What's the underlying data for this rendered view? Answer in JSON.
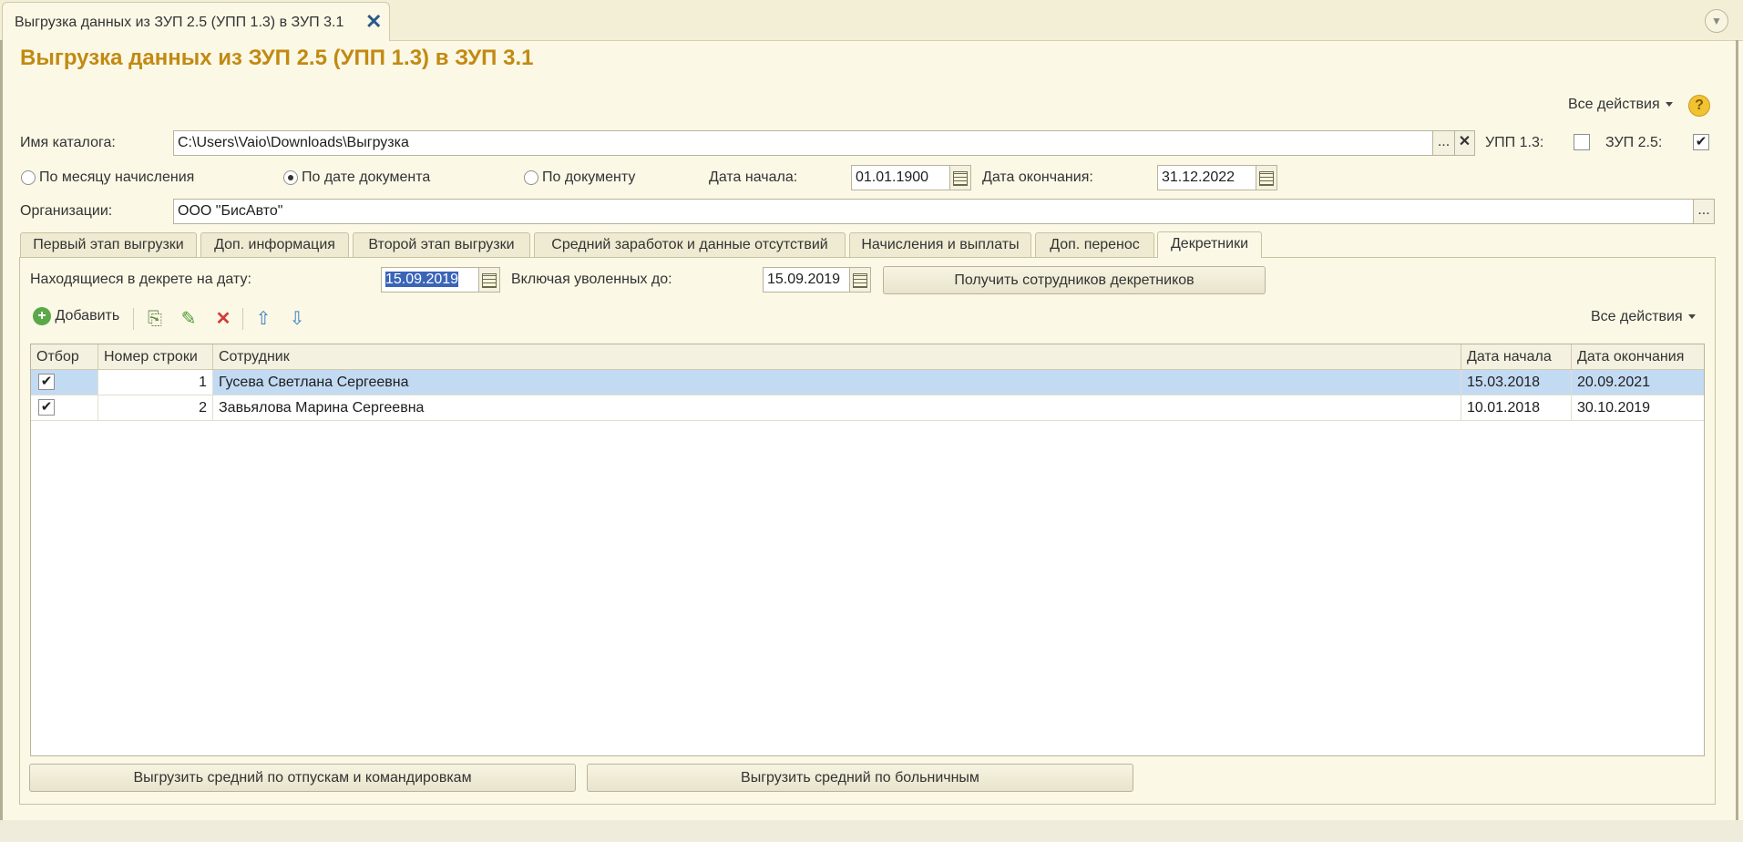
{
  "window_tab": {
    "title": "Выгрузка данных из ЗУП 2.5 (УПП 1.3) в ЗУП 3.1"
  },
  "page_title": "Выгрузка данных из ЗУП 2.5 (УПП 1.3) в ЗУП 3.1",
  "all_actions": "Все действия",
  "help_symbol": "?",
  "catalog": {
    "label": "Имя каталога:",
    "value": "C:\\Users\\Vaio\\Downloads\\Выгрузка",
    "select_symbol": "...",
    "clear_symbol": "✕"
  },
  "upp": {
    "label": "УПП 1.3:",
    "checked": false
  },
  "zup": {
    "label": "ЗУП 2.5:",
    "checked": true
  },
  "radios": [
    {
      "label": "По месяцу начисления",
      "selected": false
    },
    {
      "label": "По дате документа",
      "selected": true
    },
    {
      "label": "По документу",
      "selected": false
    }
  ],
  "date_start": {
    "label": "Дата начала:",
    "value": "01.01.1900"
  },
  "date_end": {
    "label": "Дата окончания:",
    "value": "31.12.2022"
  },
  "orgs": {
    "label": "Организации:",
    "value": "ООО \"БисАвто\"",
    "select_symbol": "..."
  },
  "tabs": [
    "Первый этап выгрузки",
    "Доп. информация",
    "Второй этап выгрузки",
    "Средний заработок и данные отсутствий",
    "Начисления и выплаты",
    "Доп. перенос",
    "Декретники"
  ],
  "active_tab": "Декретники",
  "decree": {
    "on_date_label": "Находящиеся в декрете на дату:",
    "on_date_value": "15.09.2019",
    "fired_label": "Включая уволенных до:",
    "fired_value": "15.09.2019",
    "get_button": "Получить сотрудников декретников"
  },
  "toolbar": {
    "add_label": "Добавить",
    "icons": [
      "copy-icon",
      "edit-icon",
      "delete-icon",
      "move-up-icon",
      "move-down-icon"
    ],
    "all_actions": "Все действия"
  },
  "table": {
    "columns": [
      "Отбор",
      "Номер строки",
      "Сотрудник",
      "Дата начала",
      "Дата окончания"
    ],
    "rows": [
      {
        "checked": true,
        "num": "1",
        "employee": "Гусева Светлана Сергеевна",
        "start": "15.03.2018",
        "end": "20.09.2021",
        "selected": true
      },
      {
        "checked": true,
        "num": "2",
        "employee": "Завьялова Марина Сергеевна",
        "start": "10.01.2018",
        "end": "30.10.2019",
        "selected": false
      }
    ]
  },
  "bottom_buttons": [
    "Выгрузить средний по отпускам и командировкам",
    "Выгрузить средний по больничным"
  ],
  "colors": {
    "title": "#c28a12",
    "background": "#fbf8e6",
    "selection": "#c3daf3"
  }
}
